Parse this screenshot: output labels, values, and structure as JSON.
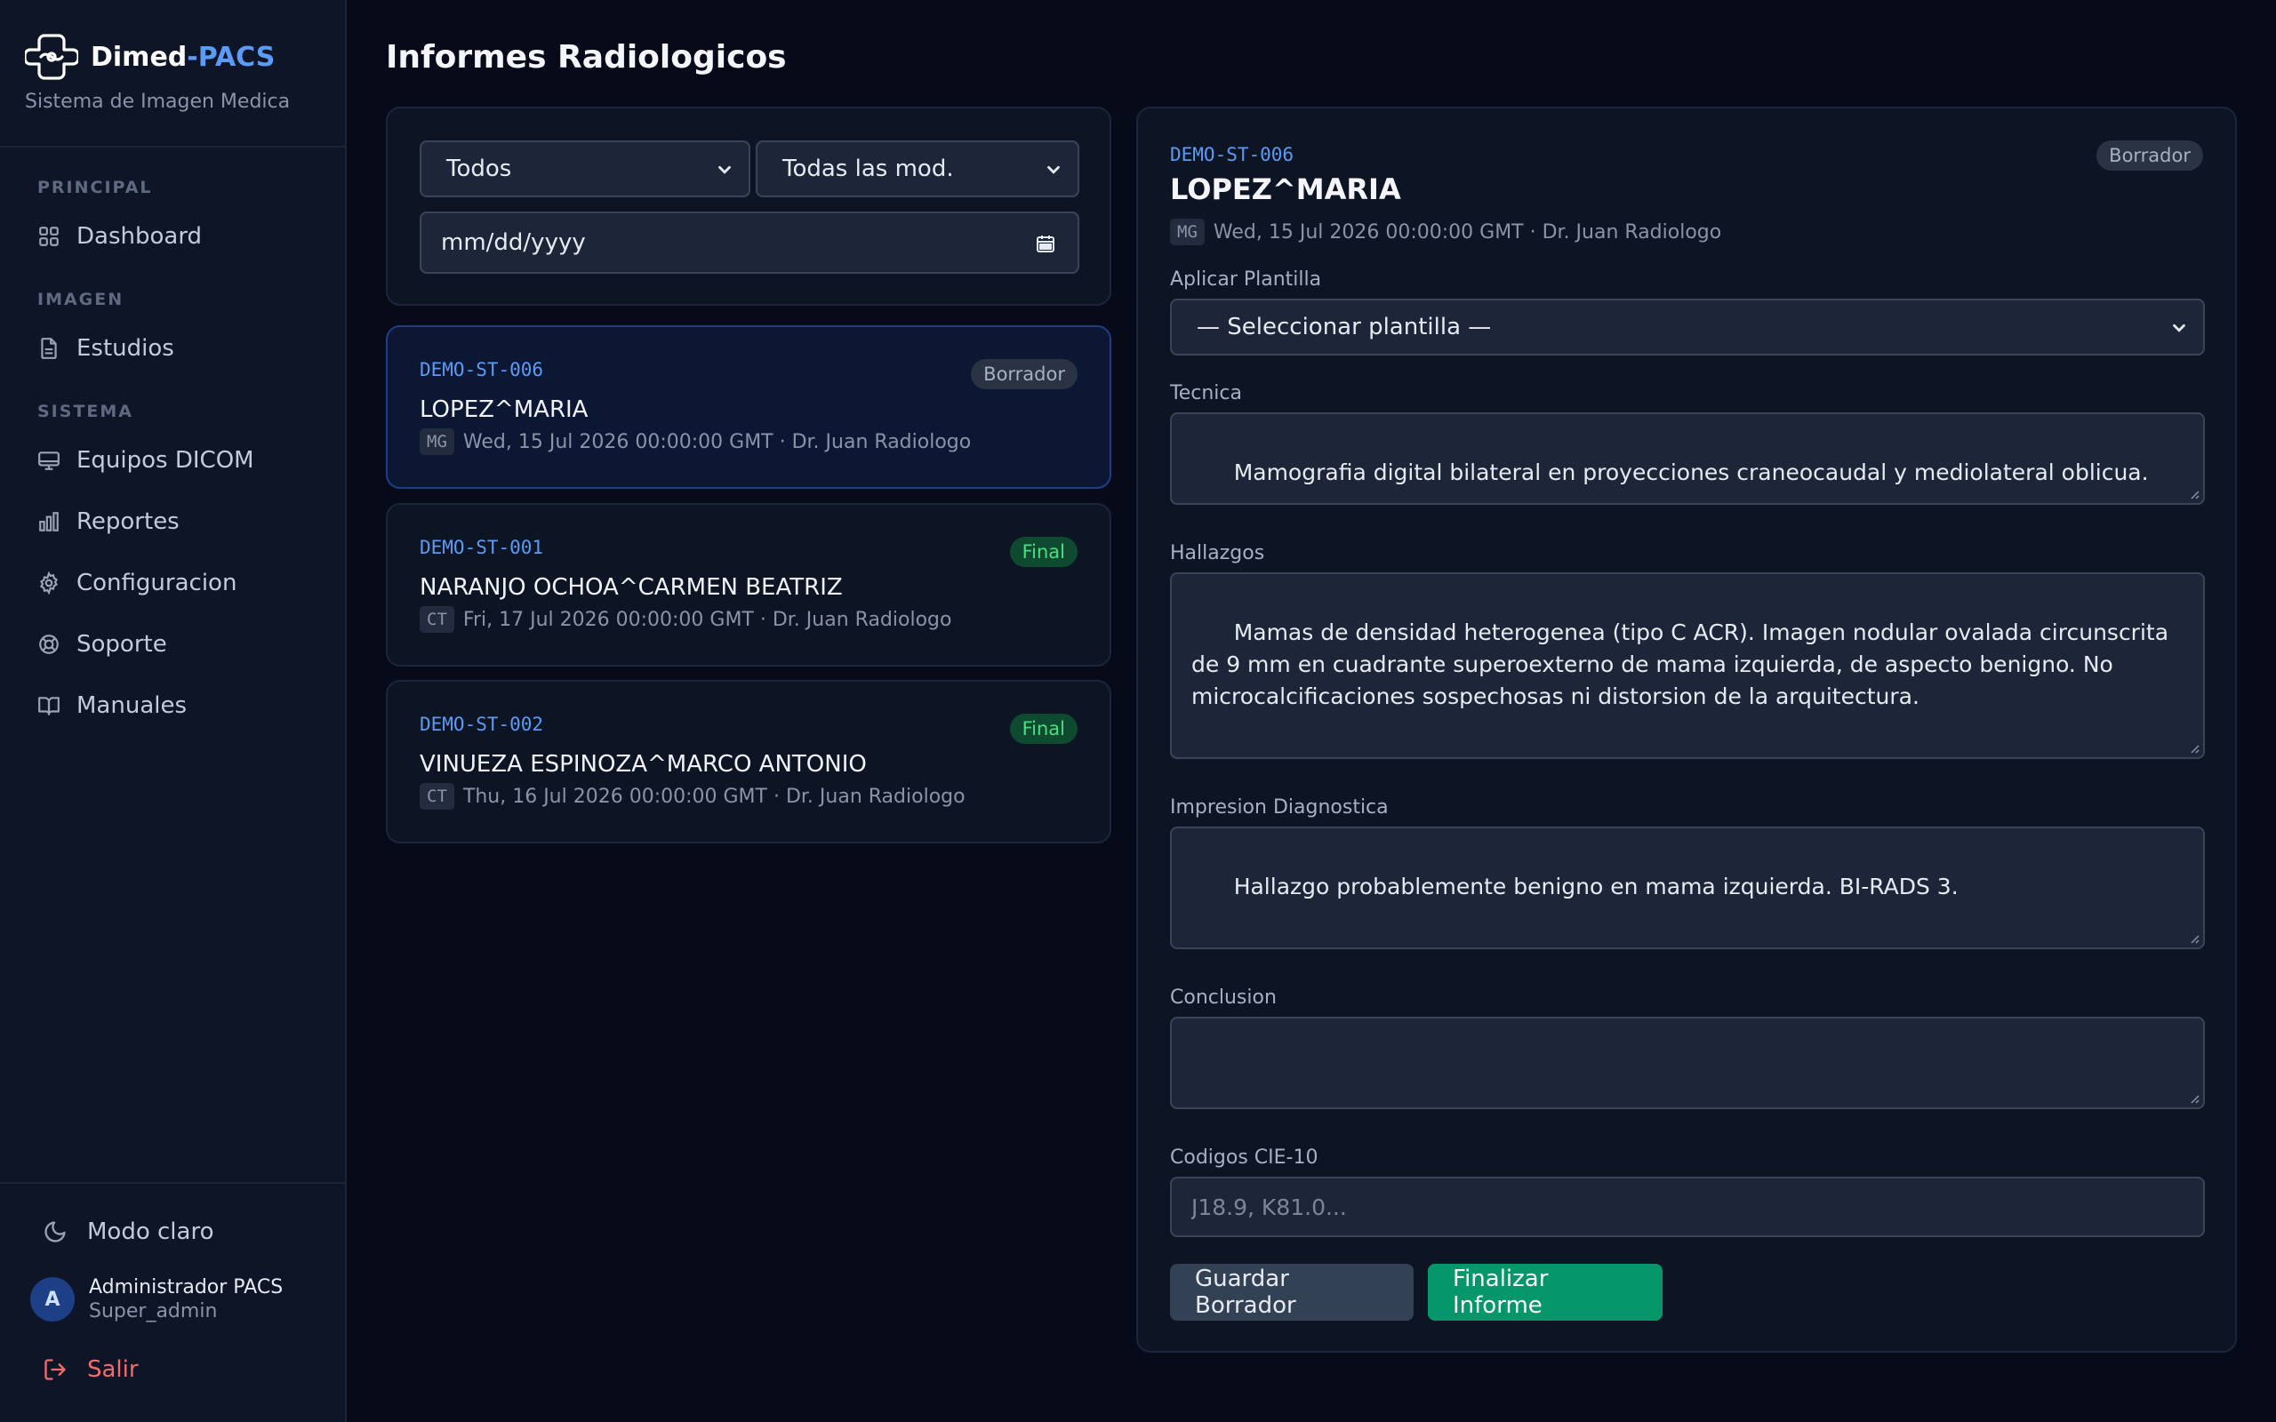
{
  "brand": {
    "name_prefix": "Dimed",
    "name_suffix": "-PACS",
    "subtitle": "Sistema de Imagen Medica"
  },
  "sidebar": {
    "sections": {
      "principal": "PRINCIPAL",
      "imagen": "IMAGEN",
      "sistema": "SISTEMA"
    },
    "items": [
      {
        "label": "Dashboard",
        "icon": "grid-icon"
      },
      {
        "label": "Estudios",
        "icon": "document-icon"
      },
      {
        "label": "Equipos DICOM",
        "icon": "monitor-icon"
      },
      {
        "label": "Reportes",
        "icon": "bar-chart-icon"
      },
      {
        "label": "Configuracion",
        "icon": "gear-icon"
      },
      {
        "label": "Soporte",
        "icon": "lifebuoy-icon"
      },
      {
        "label": "Manuales",
        "icon": "book-icon"
      }
    ],
    "theme_toggle": "Modo claro",
    "user": {
      "initial": "A",
      "name": "Administrador PACS",
      "role": "Super_admin"
    },
    "logout": "Salir"
  },
  "page": {
    "title": "Informes Radiologicos"
  },
  "filters": {
    "status_value": "Todos",
    "modality_value": "Todas las mod.",
    "date_placeholder": "mm/dd/yyyy"
  },
  "reports": [
    {
      "id": "DEMO-ST-006",
      "patient": "LOPEZ^MARIA",
      "modality": "MG",
      "date": "Wed, 15 Jul 2026 00:00:00 GMT",
      "doctor": "Dr. Juan Radiologo",
      "status": "Borrador",
      "meta": "Wed, 15 Jul 2026 00:00:00 GMT · Dr. Juan Radiologo"
    },
    {
      "id": "DEMO-ST-001",
      "patient": "NARANJO OCHOA^CARMEN BEATRIZ",
      "modality": "CT",
      "date": "Fri, 17 Jul 2026 00:00:00 GMT",
      "doctor": "Dr. Juan Radiologo",
      "status": "Final",
      "meta": "Fri, 17 Jul 2026 00:00:00 GMT · Dr. Juan Radiologo"
    },
    {
      "id": "DEMO-ST-002",
      "patient": "VINUEZA ESPINOZA^MARCO ANTONIO",
      "modality": "CT",
      "date": "Thu, 16 Jul 2026 00:00:00 GMT",
      "doctor": "Dr. Juan Radiologo",
      "status": "Final",
      "meta": "Thu, 16 Jul 2026 00:00:00 GMT · Dr. Juan Radiologo"
    }
  ],
  "editor": {
    "id": "DEMO-ST-006",
    "patient": "LOPEZ^MARIA",
    "modality": "MG",
    "meta": "Wed, 15 Jul 2026 00:00:00 GMT · Dr. Juan Radiologo",
    "status": "Borrador",
    "template_label": "Aplicar Plantilla",
    "template_value": "— Seleccionar plantilla —",
    "tecnica_label": "Tecnica",
    "tecnica_value": "Mamografia digital bilateral en proyecciones craneocaudal y mediolateral oblicua.",
    "hallazgos_label": "Hallazgos",
    "hallazgos_value": "Mamas de densidad heterogenea (tipo C ACR). Imagen nodular ovalada circunscrita de 9 mm en cuadrante superoexterno de mama izquierda, de aspecto benigno. No microcalcificaciones sospechosas ni distorsion de la arquitectura.",
    "impresion_label": "Impresion Diagnostica",
    "impresion_value": "Hallazgo probablemente benigno en mama izquierda. BI-RADS 3.",
    "conclusion_label": "Conclusion",
    "conclusion_value": "",
    "cie_label": "Codigos CIE-10",
    "cie_placeholder": "J18.9, K81.0...",
    "save_label": "Guardar Borrador",
    "finalize_label": "Finalizar Informe"
  },
  "colors": {
    "accent_blue": "#5b9bf5",
    "final_green": "#4ade80",
    "primary_button": "#059669",
    "logout_red": "#f56b6b"
  }
}
